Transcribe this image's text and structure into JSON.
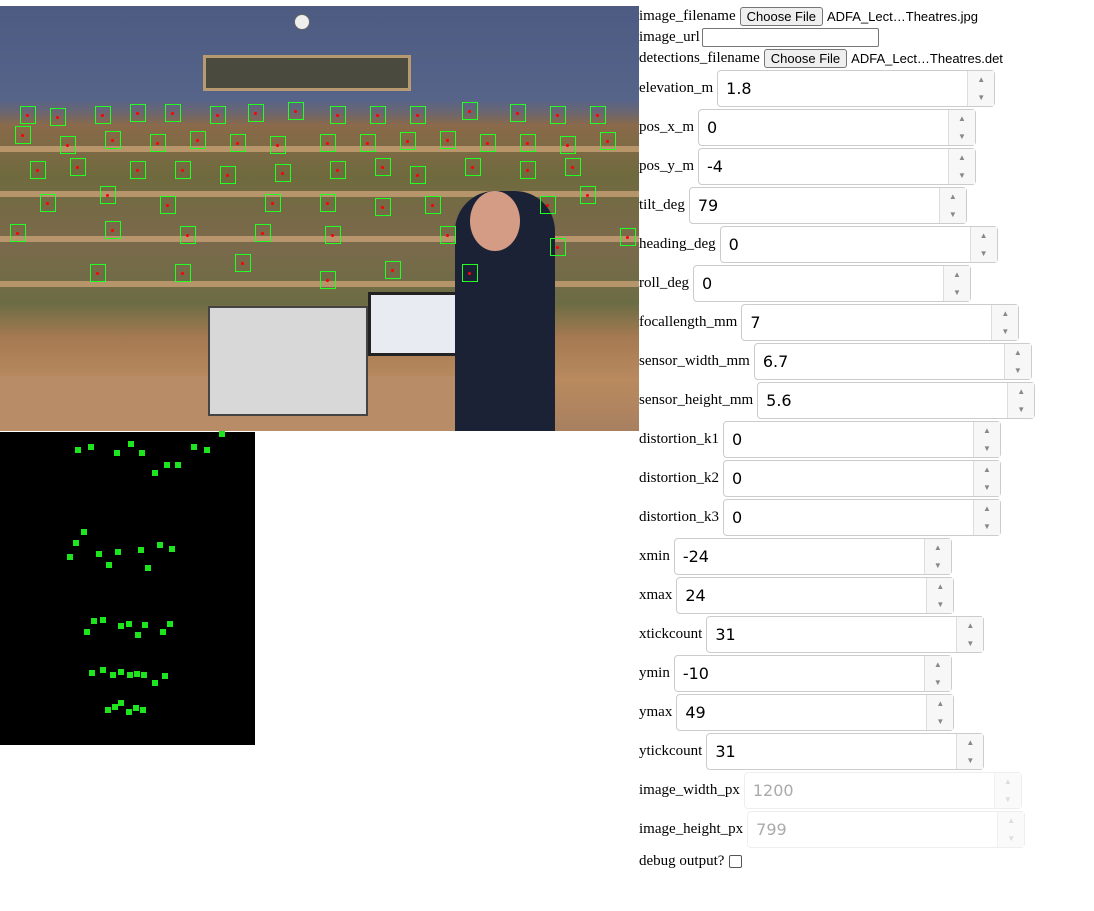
{
  "file_inputs": [
    {
      "label": "image_filename",
      "button": "Choose File",
      "file": "ADFA_Lect…Theatres.jpg"
    },
    {
      "label": "detections_filename",
      "button": "Choose File",
      "file": "ADFA_Lect…Theatres.det"
    }
  ],
  "image_url": {
    "label": "image_url",
    "value": ""
  },
  "fields": [
    {
      "label": "elevation_m",
      "value": "1.8"
    },
    {
      "label": "pos_x_m",
      "value": "0"
    },
    {
      "label": "pos_y_m",
      "value": "-4"
    },
    {
      "label": "tilt_deg",
      "value": "79"
    },
    {
      "label": "heading_deg",
      "value": "0"
    },
    {
      "label": "roll_deg",
      "value": "0"
    },
    {
      "label": "focallength_mm",
      "value": "7"
    },
    {
      "label": "sensor_width_mm",
      "value": "6.7"
    },
    {
      "label": "sensor_height_mm",
      "value": "5.6"
    },
    {
      "label": "distortion_k1",
      "value": "0"
    },
    {
      "label": "distortion_k2",
      "value": "0"
    },
    {
      "label": "distortion_k3",
      "value": "0"
    },
    {
      "label": "xmin",
      "value": "-24"
    },
    {
      "label": "xmax",
      "value": "24"
    },
    {
      "label": "xtickcount",
      "value": "31"
    },
    {
      "label": "ymin",
      "value": "-10"
    },
    {
      "label": "ymax",
      "value": "49"
    },
    {
      "label": "ytickcount",
      "value": "31"
    },
    {
      "label": "image_width_px",
      "value": "1200",
      "disabled": true
    },
    {
      "label": "image_height_px",
      "value": "799",
      "disabled": true
    }
  ],
  "debug": {
    "label": "debug output?",
    "checked": false
  },
  "colors": {
    "detection_box": "#22ff22",
    "projected_point": "#1ee61e",
    "marker": "#ff0000",
    "canvas_bg": "#000000"
  }
}
